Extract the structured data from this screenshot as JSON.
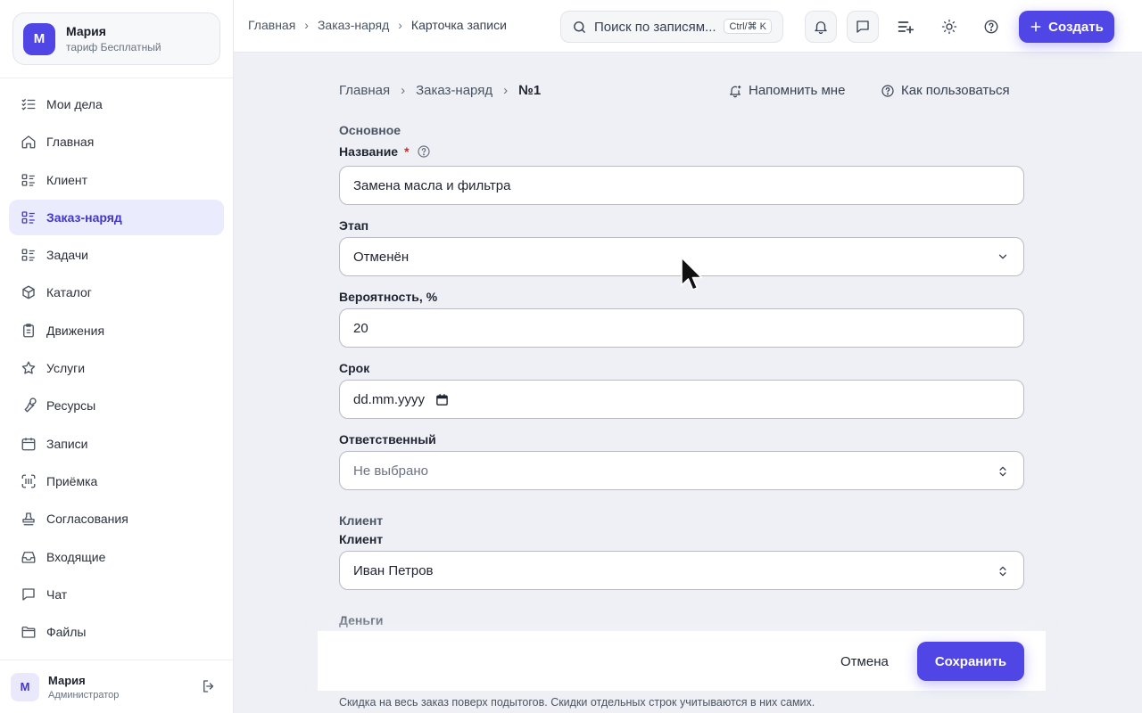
{
  "account": {
    "initial": "М",
    "name": "Мария",
    "plan": "тариф Бесплатный"
  },
  "nav": [
    {
      "label": "Мои дела",
      "icon": "task-list-icon"
    },
    {
      "label": "Главная",
      "icon": "home-icon"
    },
    {
      "label": "Клиент",
      "icon": "list-icon"
    },
    {
      "label": "Заказ-наряд",
      "icon": "list-icon",
      "active": true
    },
    {
      "label": "Задачи",
      "icon": "list-icon"
    },
    {
      "label": "Каталог",
      "icon": "box-icon"
    },
    {
      "label": "Движения",
      "icon": "clipboard-icon"
    },
    {
      "label": "Услуги",
      "icon": "star-icon"
    },
    {
      "label": "Ресурсы",
      "icon": "wrench-icon"
    },
    {
      "label": "Записи",
      "icon": "calendar-icon"
    },
    {
      "label": "Приёмка",
      "icon": "scan-icon"
    },
    {
      "label": "Согласования",
      "icon": "stamp-icon"
    },
    {
      "label": "Входящие",
      "icon": "inbox-icon"
    },
    {
      "label": "Чат",
      "icon": "chat-icon"
    },
    {
      "label": "Файлы",
      "icon": "folder-icon"
    }
  ],
  "user": {
    "initial": "М",
    "name": "Мария",
    "role": "Администратор"
  },
  "topbar": {
    "crumbs": [
      "Главная",
      "Заказ-наряд",
      "Карточка записи"
    ],
    "search_placeholder": "Поиск по записям",
    "search_display": "Поиск по записям...",
    "shortcut": "Ctrl/⌘ K",
    "create_label": "Создать"
  },
  "main": {
    "crumbs": [
      "Главная",
      "Заказ-наряд",
      "№1"
    ],
    "remind_label": "Напомнить мне",
    "howto_label": "Как пользоваться"
  },
  "form": {
    "section_main": "Основное",
    "name_label": "Название",
    "name_value": "Замена масла и фильтра",
    "stage_label": "Этап",
    "stage_value": "Отменён",
    "probability_label": "Вероятность, %",
    "probability_value": "20",
    "deadline_label": "Срок",
    "deadline_value": "dd.mm.yyyy",
    "responsible_label": "Ответственный",
    "responsible_value": "Не выбрано",
    "section_client": "Клиент",
    "client_label": "Клиент",
    "client_value": "Иван Петров",
    "section_money": "Деньги",
    "discount_hint": "Скидка на весь заказ поверх подытогов. Скидки отдельных строк учитываются в них самих."
  },
  "actions": {
    "cancel_label": "Отмена",
    "save_label": "Сохранить"
  },
  "colors": {
    "accent": "#4f46e5",
    "active_bg": "#eaebfd",
    "required": "#dc2626"
  }
}
